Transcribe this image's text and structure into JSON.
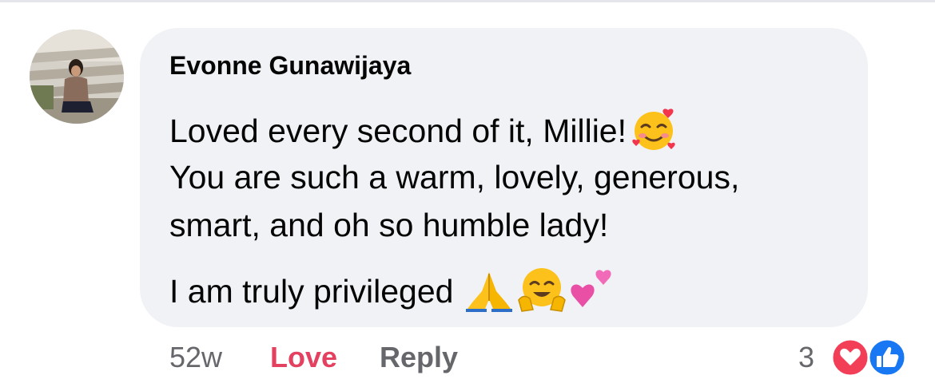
{
  "comment": {
    "author": "Evonne Gunawijaya",
    "lines": [
      "Loved every second of it, Millie!",
      "You are such a warm, lovely, generous,",
      "smart, and oh so humble lady!",
      "I am truly privileged"
    ],
    "emoji_icons": [
      "smiling-face-with-hearts-icon",
      "folded-hands-icon",
      "hugging-face-icon",
      "two-hearts-icon"
    ]
  },
  "actions": {
    "time": "52w",
    "love_label": "Love",
    "reply_label": "Reply"
  },
  "reactions": {
    "count": "3",
    "icons": [
      "love-reaction-icon",
      "like-reaction-icon"
    ],
    "colors": {
      "love": "#f33e58",
      "like": "#1877f2"
    }
  },
  "colors": {
    "bubble": "#f0f2f5",
    "text": "#050505",
    "meta": "#65676b",
    "love_accent": "#e4405f"
  }
}
